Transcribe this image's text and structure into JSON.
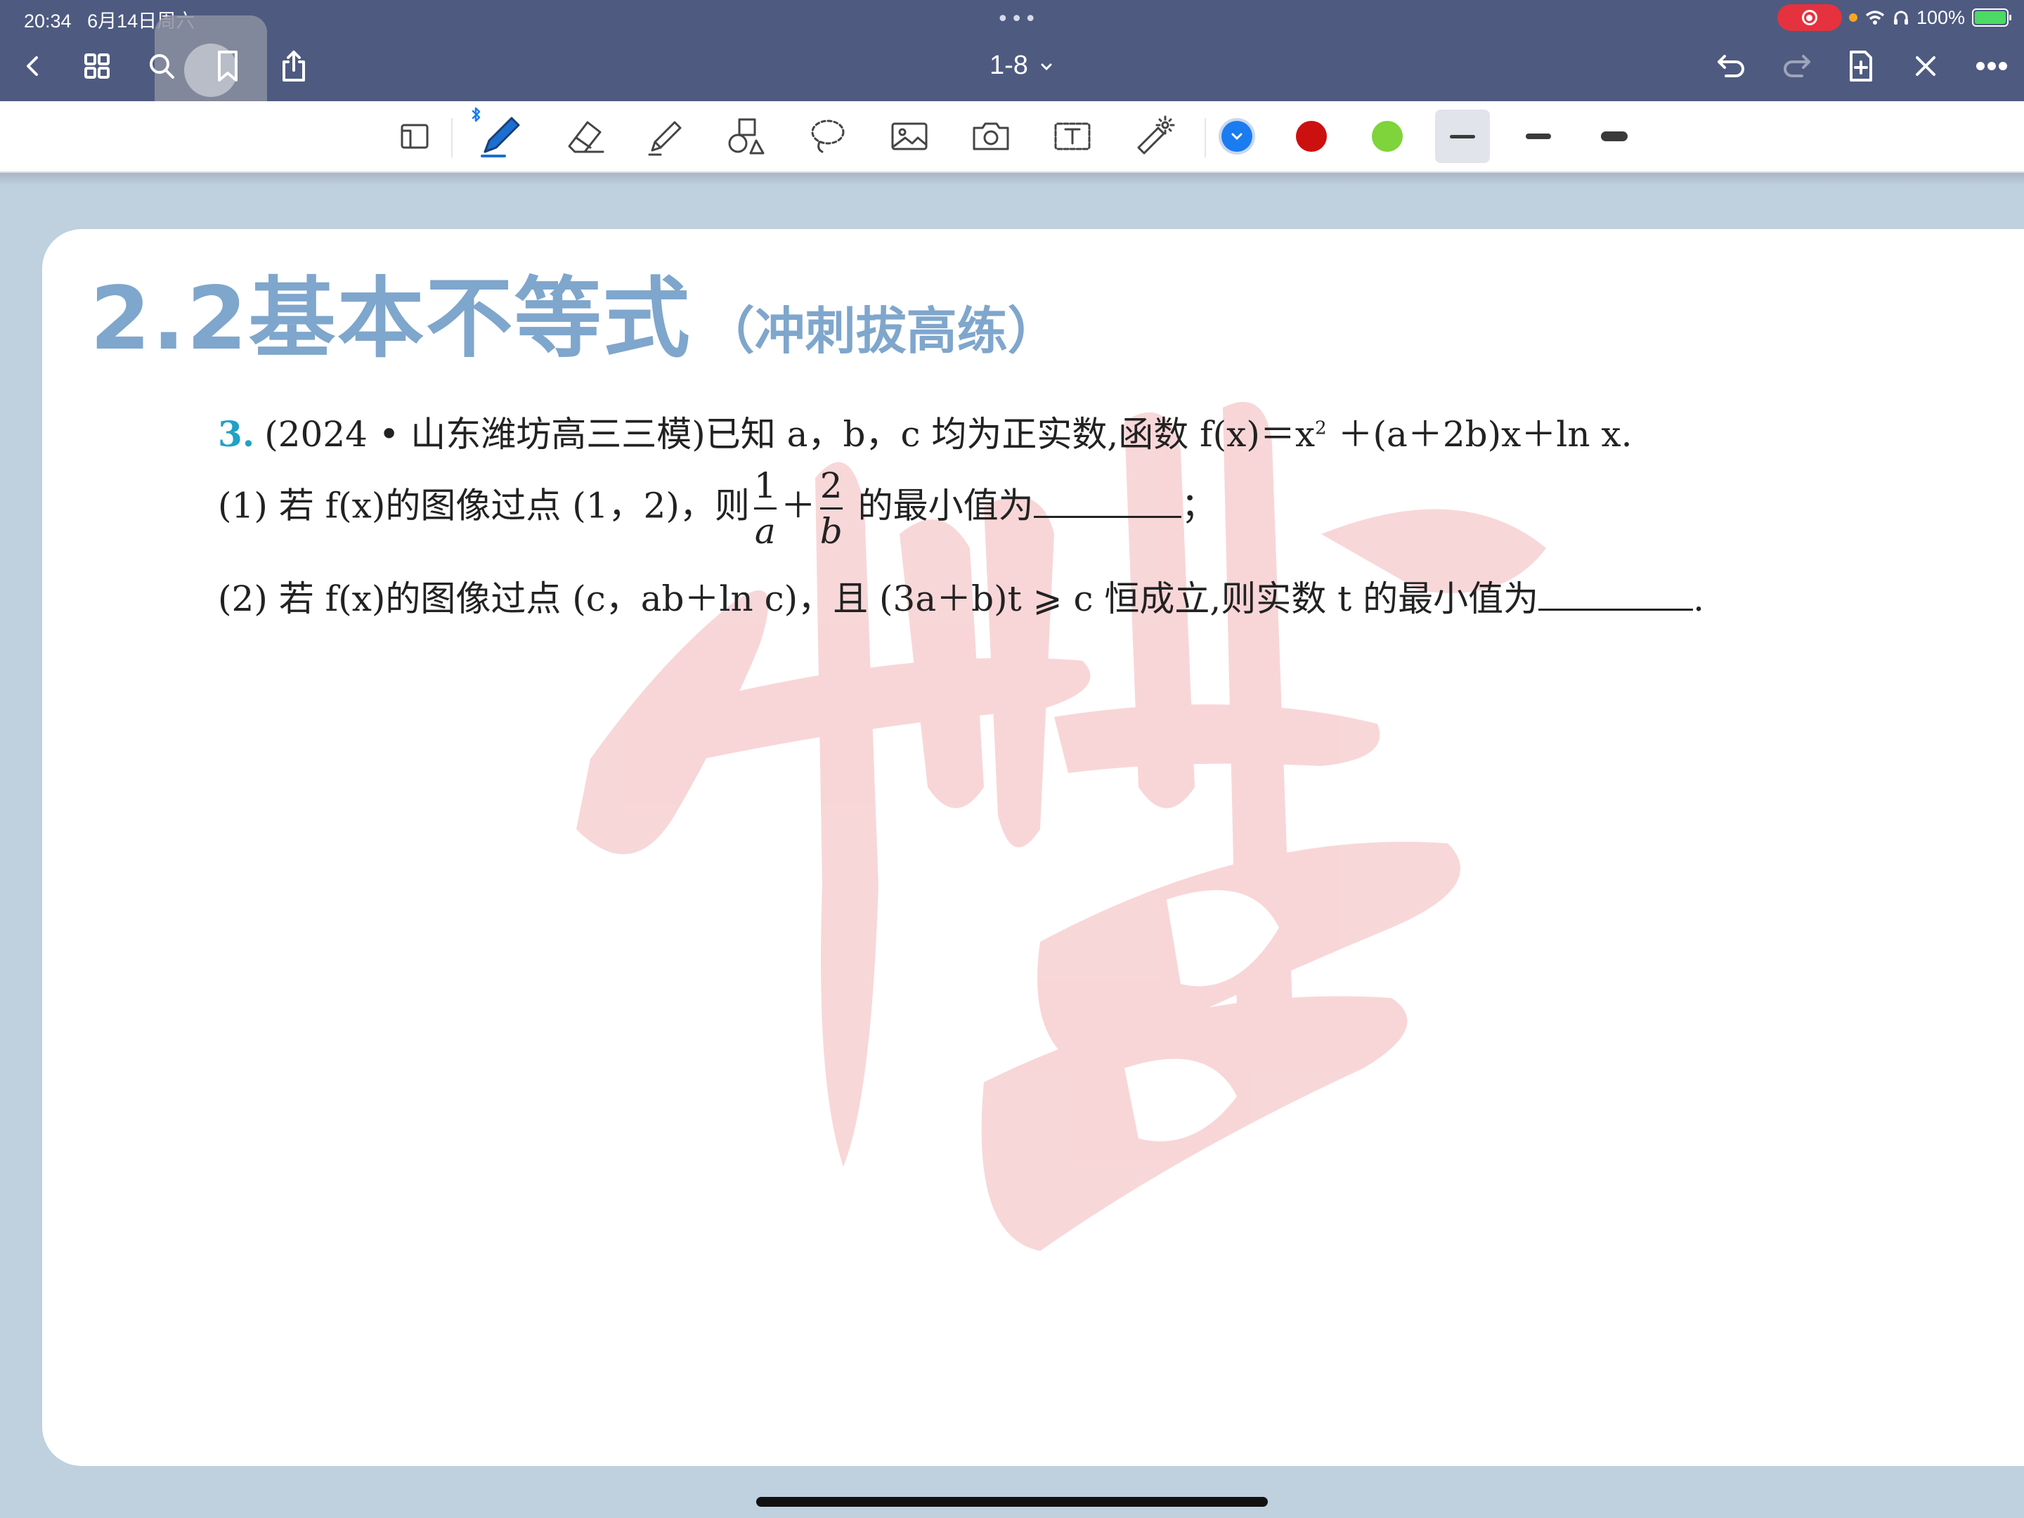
{
  "status_bar": {
    "time": "20:34",
    "date": "6月14日周六",
    "dots": "•••",
    "battery": "100%"
  },
  "nav": {
    "doc_title": "1-8",
    "icons": [
      "back-icon",
      "grid-icon",
      "search-icon",
      "bookmark-icon",
      "share-icon",
      "undo-icon",
      "redo-icon",
      "add-page-icon",
      "close-icon",
      "more-icon"
    ]
  },
  "toolbar": {
    "tools": [
      "page-view-icon",
      "pen-icon",
      "eraser-icon",
      "highlighter-icon",
      "shapes-icon",
      "lasso-icon",
      "image-icon",
      "camera-icon",
      "text-box-icon",
      "laser-pointer-icon"
    ],
    "colors": [
      {
        "name": "blue",
        "hex": "#1a7cf0"
      },
      {
        "name": "red",
        "hex": "#cc1010"
      },
      {
        "name": "green",
        "hex": "#7ed43a"
      }
    ]
  },
  "page": {
    "title": "2.2基本不等式",
    "title_sub": "（冲刺拔高练）",
    "question": {
      "number": "3.",
      "stem_prefix": "(2024 • 山东潍坊高三三模)已知 a，b，c 均为正实数,函数 f(x)＝x",
      "stem_sup": "2",
      "stem_suffix": " ＋(a＋2b)x＋ln x.",
      "part1_prefix": "(1) 若 f(x)的图像过点 (1，2)，则",
      "frac1_num": "1",
      "frac1_den": "a",
      "plus": "＋",
      "frac2_num": "2",
      "frac2_den": "b",
      "part1_suffix": "的最小值为",
      "part1_end": "；",
      "part2_text": "(2) 若 f(x)的图像过点 (c，ab＋ln c)，且 (3a＋b)t ⩾ c 恒成立,则实数 t 的最小值为",
      "part2_end": "."
    }
  }
}
